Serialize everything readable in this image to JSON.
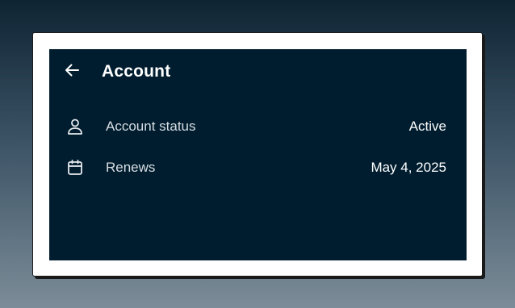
{
  "app_bar": {
    "back_icon": "arrow-back-icon",
    "title": "Account"
  },
  "rows": [
    {
      "icon": "person-icon",
      "label": "Account status",
      "value": "Active"
    },
    {
      "icon": "calendar-icon",
      "label": "Renews",
      "value": "May 4, 2025"
    }
  ],
  "colors": {
    "screen_background": "#001d2f",
    "text_primary": "#ffffff",
    "text_secondary": "#d8dde2"
  }
}
